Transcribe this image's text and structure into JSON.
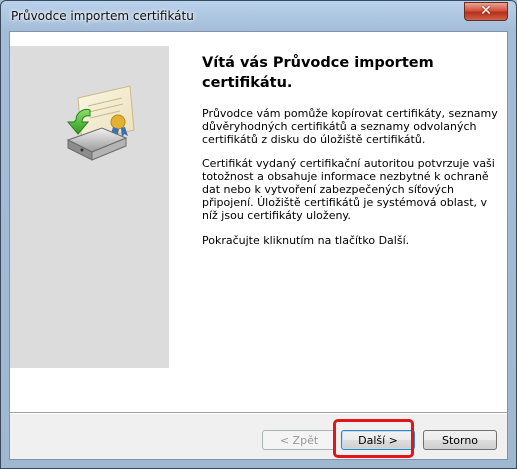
{
  "window": {
    "title": "Průvodce importem certifikátu",
    "close_label": "✕"
  },
  "content": {
    "heading": "Vítá vás Průvodce importem certifikátu.",
    "paragraph1": "Průvodce vám pomůže kopírovat certifikáty, seznamy důvěryhodných certifikátů a seznamy odvolaných certifikátů z disku do úložiště certifikátů.",
    "paragraph2": "Certifikát vydaný certifikační autoritou potvrzuje vaši totožnost a obsahuje informace nezbytné k ochraně dat nebo k vytvoření zabezpečených síťových připojení. Úložiště certifikátů je systémová oblast, v níž jsou certifikáty uloženy.",
    "paragraph3": "Pokračujte kliknutím na tlačítko Další."
  },
  "buttons": {
    "back": "< Zpět",
    "next": "Další >",
    "cancel": "Storno"
  },
  "colors": {
    "highlight": "#e0161b",
    "side_panel": "#dcdcdc"
  },
  "icons": {
    "wizard": "certificate-import-icon"
  }
}
